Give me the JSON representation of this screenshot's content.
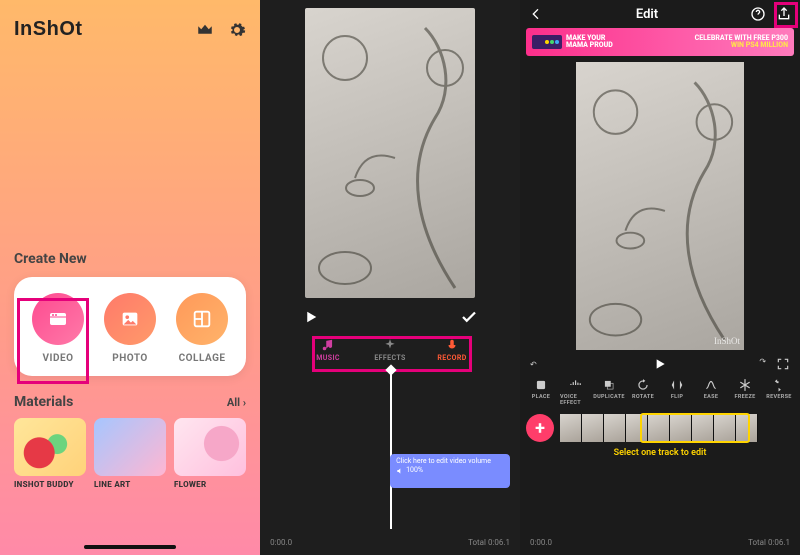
{
  "panel1": {
    "logo": "InShOt",
    "createTitle": "Create New",
    "buttons": {
      "video": "VIDEO",
      "photo": "PHOTO",
      "collage": "COLLAGE"
    },
    "materialsTitle": "Materials",
    "allLabel": "All ›",
    "materials": [
      "INSHOT BUDDY",
      "LINE ART",
      "FLOWER"
    ]
  },
  "panel2": {
    "tabs": {
      "music": "MUSIC",
      "effects": "EFFECTS",
      "record": "RECORD"
    },
    "volumeHint": "Click here to edit video volume",
    "volumeValue": "100%",
    "timeCurrent": "0:00.0",
    "timeTotal": "Total 0:06.1"
  },
  "panel3": {
    "title": "Edit",
    "ad": {
      "line1": "MAKE YOUR",
      "line2": "MAMA PROUD",
      "r1": "CELEBRATE WITH FREE P300",
      "r2": "WIN PS4 MILLION"
    },
    "watermark": "InShOt",
    "toolbar": [
      "PLACE",
      "VOICE EFFECT",
      "DUPLICATE",
      "ROTATE",
      "FLIP",
      "EASE",
      "FREEZE",
      "REVERSE"
    ],
    "hint": "Select one track to edit",
    "timeCurrent": "0:00.0",
    "timeTotal": "Total 0:06.1"
  }
}
